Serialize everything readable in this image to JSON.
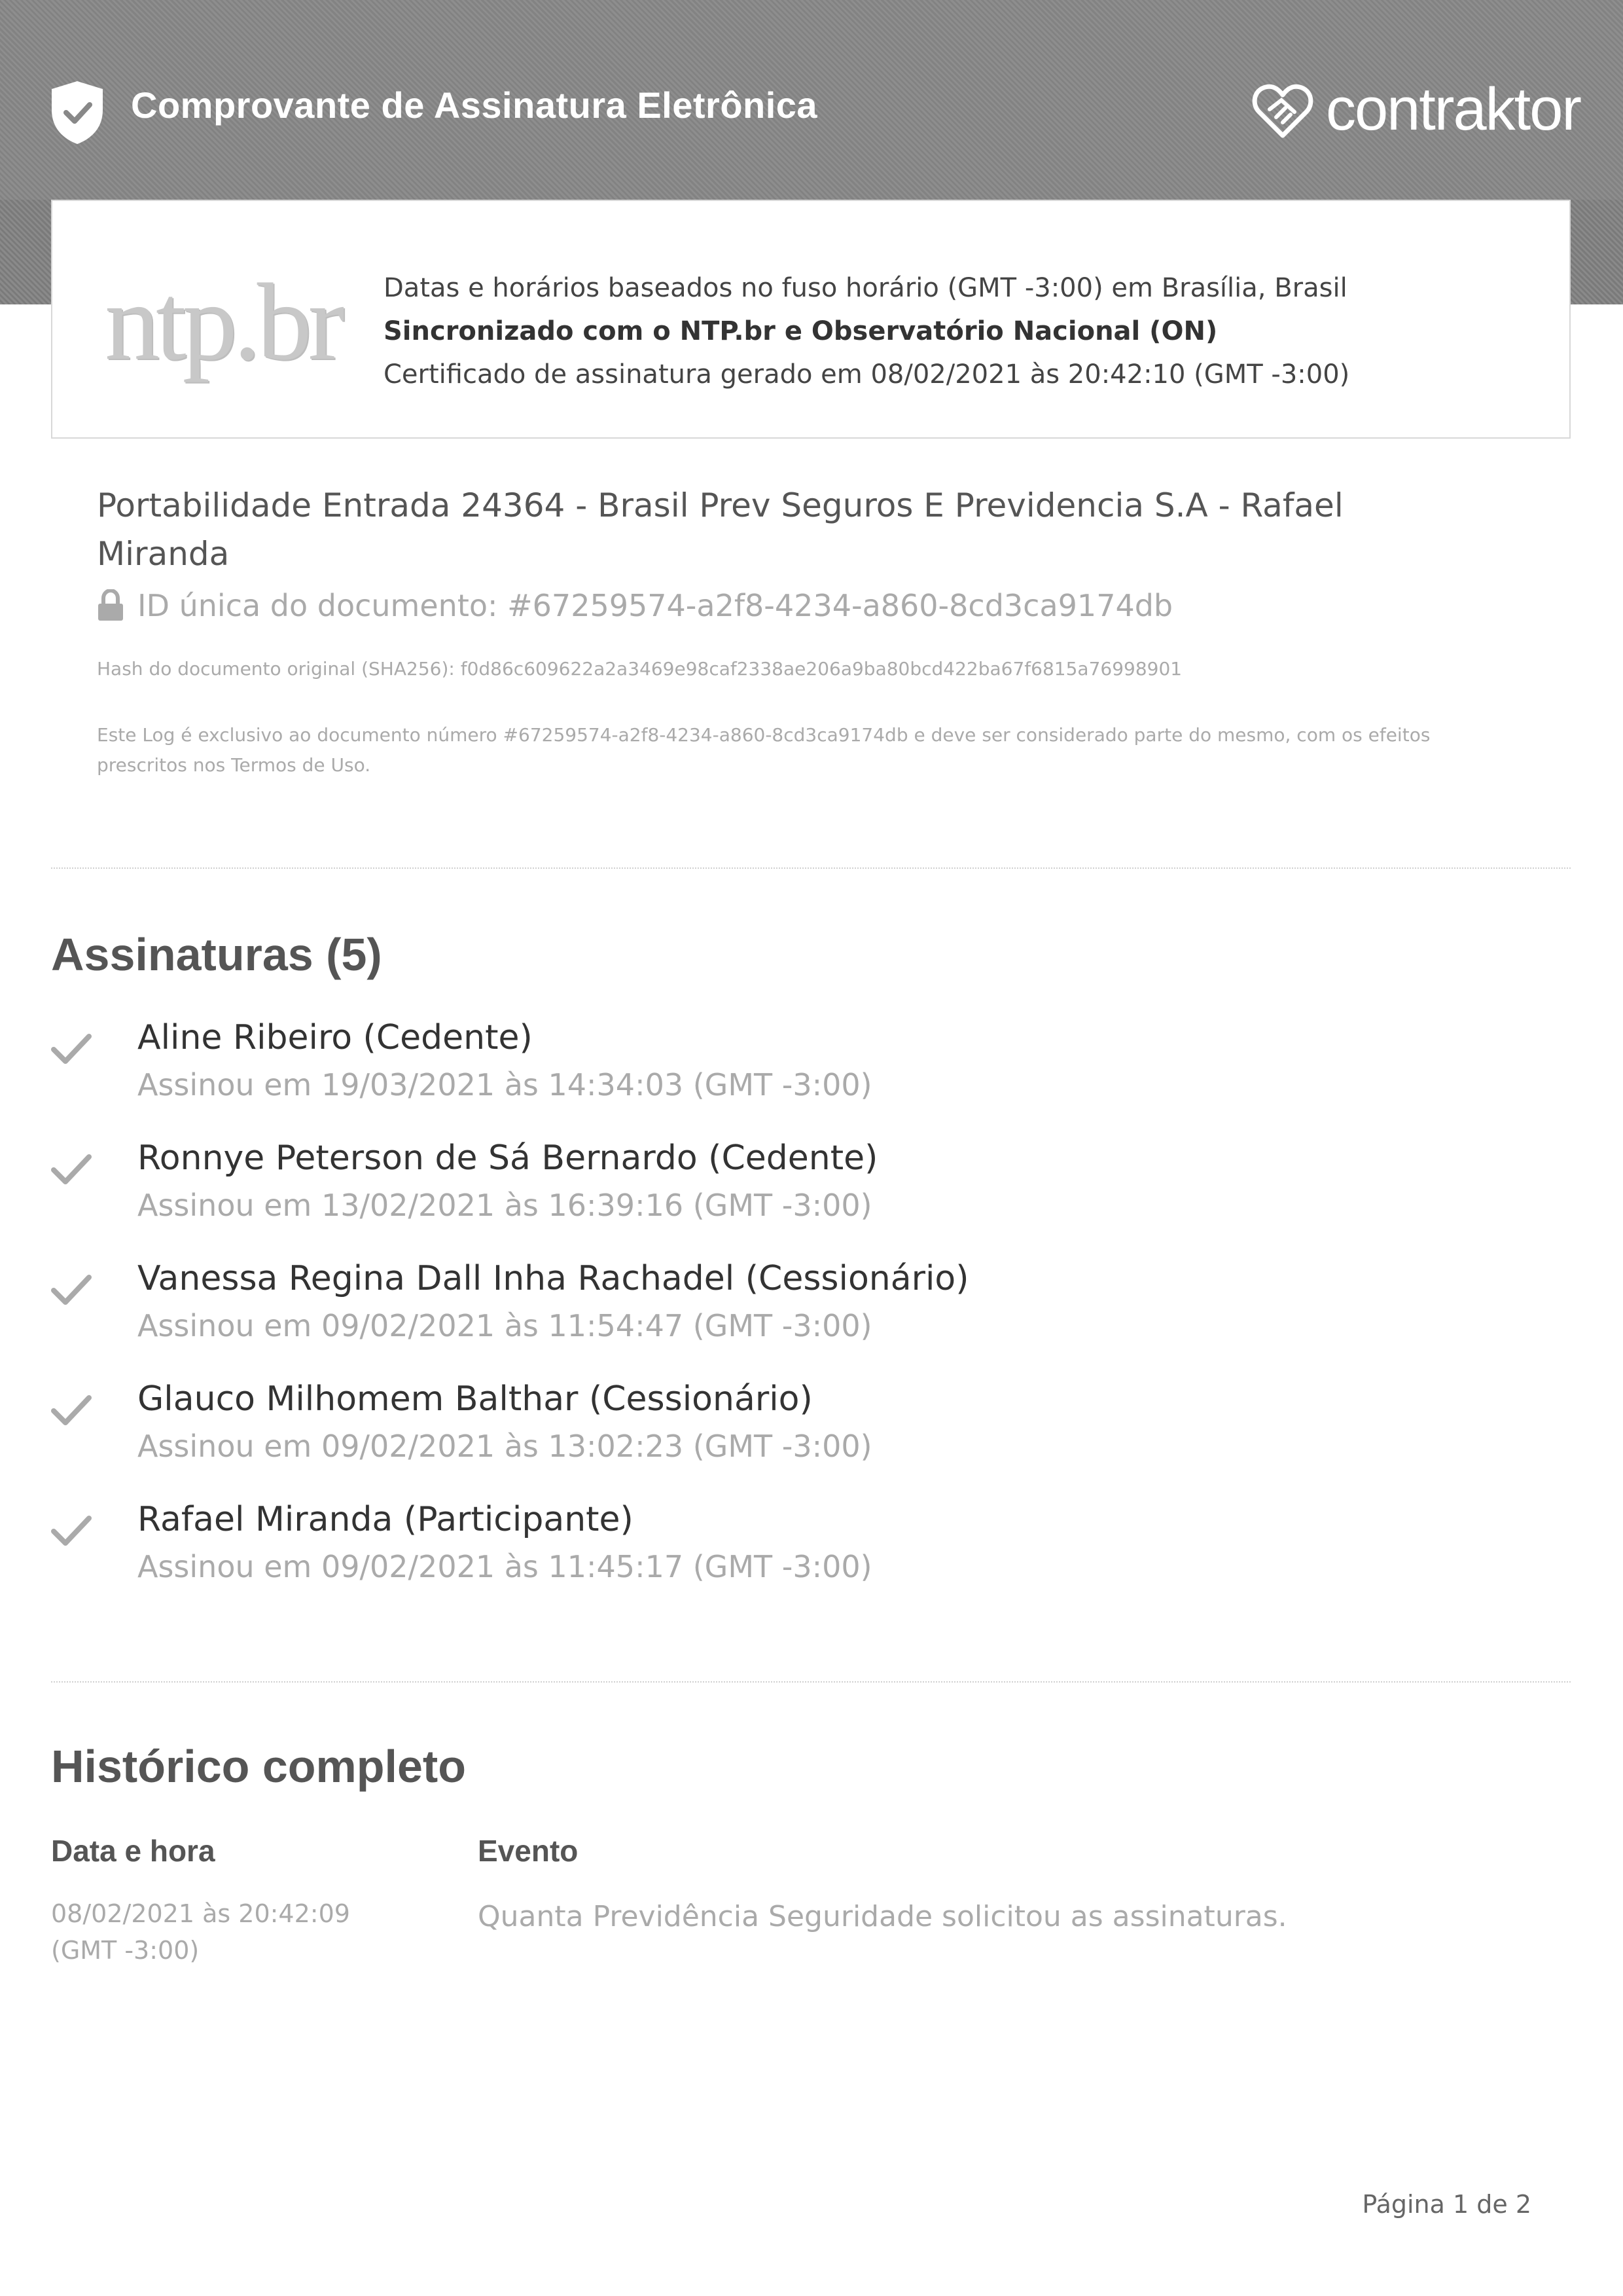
{
  "header": {
    "title": "Comprovante de Assinatura Eletrônica",
    "brand": "contraktor",
    "shield_icon": "shield-check-icon",
    "brand_icon": "handshake-heart-icon"
  },
  "timezone_card": {
    "logo_text": "ntp.br",
    "line1": "Datas e horários baseados no fuso horário (GMT -3:00) em Brasília, Brasil",
    "line2": "Sincronizado com o NTP.br e Observatório Nacional (ON)",
    "line3": "Certificado de assinatura gerado em 08/02/2021 às 20:42:10 (GMT -3:00)"
  },
  "document": {
    "title": "Portabilidade Entrada 24364 - Brasil Prev Seguros E Previdencia S.A - Rafael Miranda",
    "id_label": "ID única do documento: #67259574-a2f8-4234-a860-8cd3ca9174db",
    "hash": "Hash do documento original (SHA256): f0d86c609622a2a3469e98caf2338ae206a9ba80bcd422ba67f6815a76998901",
    "note": "Este Log é exclusivo ao documento número #67259574-a2f8-4234-a860-8cd3ca9174db e deve ser considerado parte do mesmo, com os efeitos prescritos nos Termos de Uso."
  },
  "signatures": {
    "title": "Assinaturas (5)",
    "items": [
      {
        "name": "Aline Ribeiro (Cedente)",
        "date": "Assinou em 19/03/2021 às 14:34:03 (GMT -3:00)"
      },
      {
        "name": "Ronnye Peterson de Sá Bernardo (Cedente)",
        "date": "Assinou em 13/02/2021 às 16:39:16 (GMT -3:00)"
      },
      {
        "name": "Vanessa Regina Dall Inha Rachadel (Cessionário)",
        "date": "Assinou em 09/02/2021 às 11:54:47 (GMT -3:00)"
      },
      {
        "name": "Glauco Milhomem Balthar (Cessionário)",
        "date": "Assinou em 09/02/2021 às 13:02:23 (GMT -3:00)"
      },
      {
        "name": "Rafael Miranda (Participante)",
        "date": "Assinou em 09/02/2021 às 11:45:17 (GMT -3:00)"
      }
    ]
  },
  "history": {
    "title": "Histórico completo",
    "col_date": "Data e hora",
    "col_event": "Evento",
    "rows": [
      {
        "date": "08/02/2021 às 20:42:09 (GMT -3:00)",
        "event": "Quanta Previdência Seguridade solicitou as assinaturas."
      }
    ]
  },
  "footer": {
    "page": "Página 1 de 2"
  }
}
